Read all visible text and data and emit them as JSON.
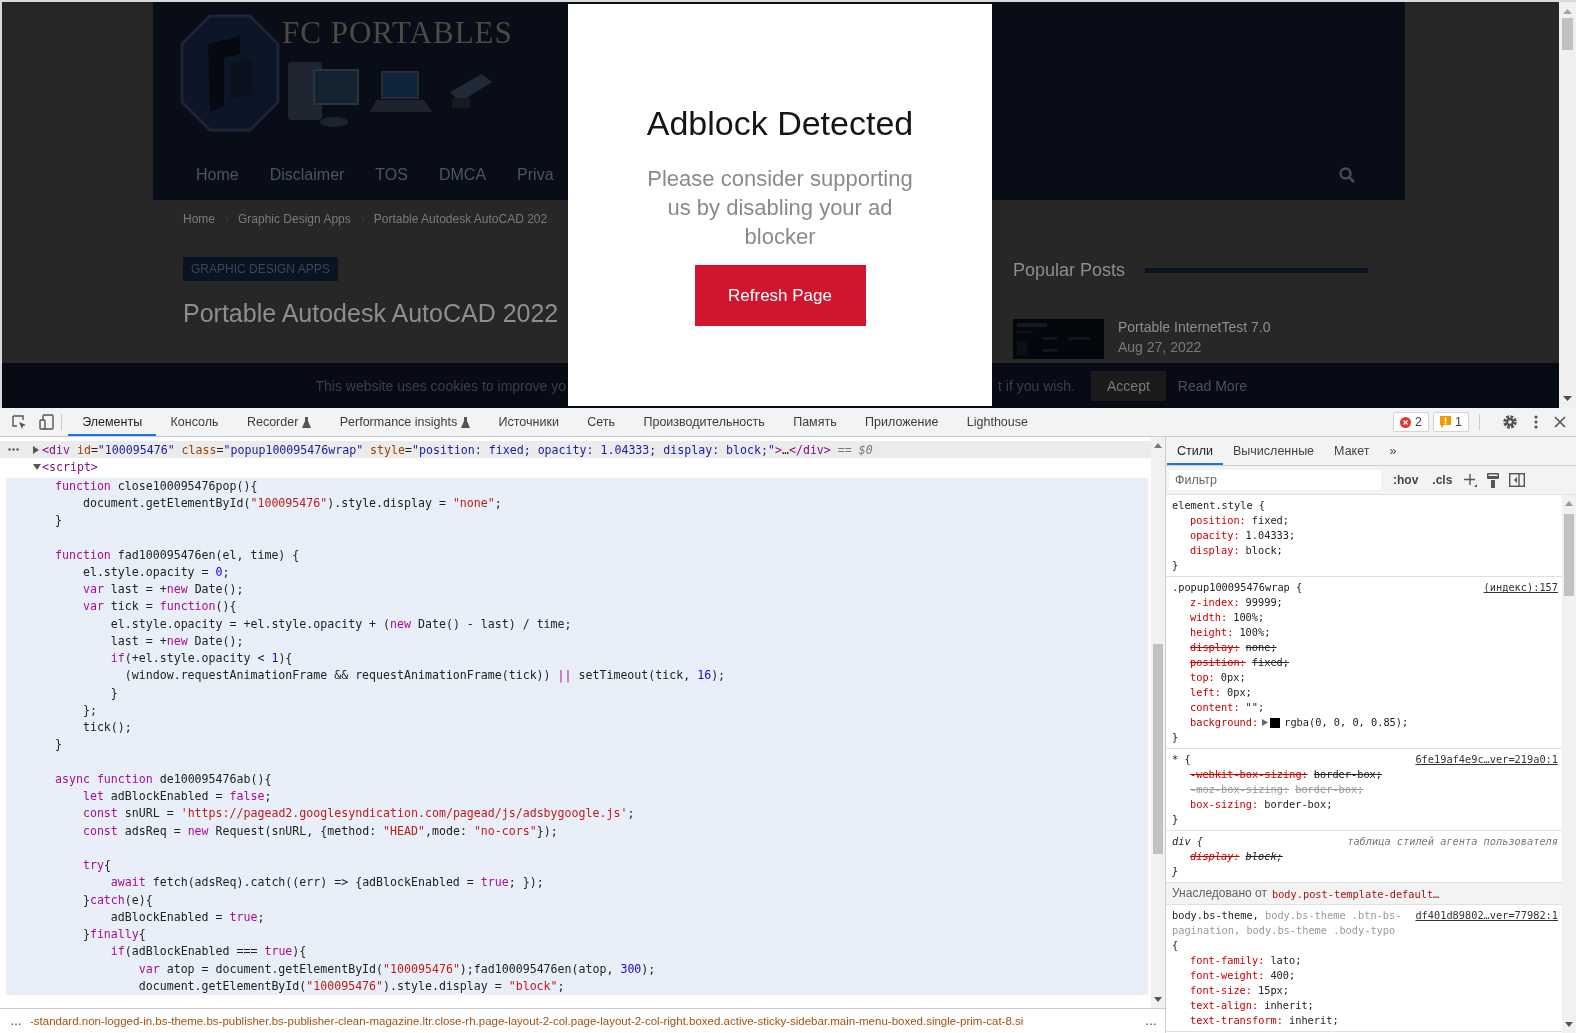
{
  "page": {
    "logo_text": "FC PORTABLES",
    "nav": [
      "Home",
      "Disclaimer",
      "TOS",
      "DMCA",
      "Priva"
    ],
    "breadcrumb": [
      "Home",
      "Graphic Design Apps",
      "Portable Autodesk AutoCAD 202"
    ],
    "category": "GRAPHIC DESIGN APPS",
    "title": "Portable Autodesk AutoCAD 2022",
    "sidebar": {
      "heading": "Popular Posts",
      "posts": [
        {
          "title": "Portable InternetTest 7.0",
          "date": "Aug 27, 2022"
        }
      ]
    },
    "cookie_bar": {
      "text_start": "This website uses cookies to improve yo",
      "text_end": "t if you wish.",
      "accept": "Accept",
      "read_more": "Read More"
    }
  },
  "modal": {
    "title": "Adblock Detected",
    "message": "Please consider supporting us by disabling your ad blocker",
    "button": "Refresh Page"
  },
  "devtools": {
    "tabs": [
      {
        "label": "Элементы",
        "selected": true,
        "experimental": false
      },
      {
        "label": "Консоль",
        "selected": false,
        "experimental": false
      },
      {
        "label": "Recorder",
        "selected": false,
        "experimental": true
      },
      {
        "label": "Performance insights",
        "selected": false,
        "experimental": true
      },
      {
        "label": "Источники",
        "selected": false,
        "experimental": false
      },
      {
        "label": "Сеть",
        "selected": false,
        "experimental": false
      },
      {
        "label": "Производительность",
        "selected": false,
        "experimental": false
      },
      {
        "label": "Память",
        "selected": false,
        "experimental": false
      },
      {
        "label": "Приложение",
        "selected": false,
        "experimental": false
      },
      {
        "label": "Lighthouse",
        "selected": false,
        "experimental": false
      }
    ],
    "errors": "2",
    "warnings": "1",
    "dom": {
      "selected_line": [
        {
          "kind": "tag",
          "text": "<div"
        },
        {
          "kind": "attribute",
          "text": " id"
        },
        "=",
        {
          "kind": "attribute-value",
          "text": "\"100095476\""
        },
        {
          "kind": "attribute",
          "text": " class"
        },
        "=",
        {
          "kind": "attribute-value",
          "text": "\"popup100095476wrap\""
        },
        {
          "kind": "attribute",
          "text": " style"
        },
        "=",
        {
          "kind": "attribute-value",
          "text": "\"position: fixed; opacity: 1.04333; display: block;\""
        },
        {
          "kind": "tag",
          "text": ">"
        },
        "…",
        {
          "kind": "tag",
          "text": "</div>"
        },
        {
          "kind": "dimmed",
          "text": " == $0"
        }
      ],
      "script_line": [
        {
          "kind": "tag",
          "text": "<script>"
        }
      ],
      "code_blocks": [
        [
          [
            {
              "kind": "keyword",
              "text": "function"
            },
            " close100095476pop(){"
          ],
          [
            "    document.getElementById(",
            {
              "kind": "string",
              "text": "\"100095476\""
            },
            ").style.display = ",
            {
              "kind": "string",
              "text": "\"none\""
            },
            ";"
          ],
          [
            "}"
          ]
        ],
        [
          [
            {
              "kind": "keyword",
              "text": "function"
            },
            " fad100095476en(el, time) {"
          ],
          [
            "    el.style.opacity = ",
            {
              "kind": "number",
              "text": "0"
            },
            ";"
          ],
          [
            {
              "kind": "keyword",
              "text": "    var"
            },
            " last = +",
            {
              "kind": "keyword",
              "text": "new"
            },
            " Date();"
          ],
          [
            {
              "kind": "keyword",
              "text": "    var"
            },
            " tick = ",
            {
              "kind": "keyword",
              "text": "function"
            },
            "(){"
          ],
          [
            "        el.style.opacity = +el.style.opacity + (",
            {
              "kind": "keyword",
              "text": "new"
            },
            " Date() - last) / time;"
          ],
          [
            "        last = +",
            {
              "kind": "keyword",
              "text": "new"
            },
            " Date();"
          ],
          [
            {
              "kind": "keyword",
              "text": "        if"
            },
            "(+el.style.opacity < ",
            {
              "kind": "number",
              "text": "1"
            },
            "){"
          ],
          [
            "          (window.requestAnimationFrame && requestAnimationFrame(tick)) ",
            {
              "kind": "keyword",
              "text": "||"
            },
            " setTimeout(tick, ",
            {
              "kind": "number",
              "text": "16"
            },
            ");"
          ],
          [
            "        }"
          ],
          [
            "    };"
          ],
          [
            "    tick();"
          ],
          [
            "}"
          ]
        ],
        [
          [
            {
              "kind": "keyword",
              "text": "async function"
            },
            " de100095476ab(){"
          ],
          [
            {
              "kind": "keyword",
              "text": "    let"
            },
            " adBlockEnabled = ",
            {
              "kind": "keyword",
              "text": "false"
            },
            ";"
          ],
          [
            {
              "kind": "keyword",
              "text": "    const"
            },
            " snURL = ",
            {
              "kind": "string",
              "text": "'https://pagead2.googlesyndication.com/pagead/js/adsbygoogle.js'"
            },
            ";"
          ],
          [
            {
              "kind": "keyword",
              "text": "    const"
            },
            " adsReq = ",
            {
              "kind": "keyword",
              "text": "new"
            },
            " Request(snURL, {method: ",
            {
              "kind": "string",
              "text": "\"HEAD\""
            },
            ",mode: ",
            {
              "kind": "string",
              "text": "\"no-cors\""
            },
            "});"
          ]
        ],
        [
          [
            {
              "kind": "keyword",
              "text": "    try"
            },
            "{"
          ],
          [
            {
              "kind": "keyword",
              "text": "        await"
            },
            " fetch(adsReq).catch((err) => {adBlockEnabled = ",
            {
              "kind": "keyword",
              "text": "true"
            },
            "; });"
          ],
          [
            "    }",
            {
              "kind": "keyword",
              "text": "catch"
            },
            "(e){"
          ],
          [
            "        adBlockEnabled = ",
            {
              "kind": "keyword",
              "text": "true"
            },
            ";"
          ],
          [
            "    }",
            {
              "kind": "keyword",
              "text": "finally"
            },
            "{"
          ],
          [
            {
              "kind": "keyword",
              "text": "        if"
            },
            "(adBlockEnabled === ",
            {
              "kind": "keyword",
              "text": "true"
            },
            "){"
          ],
          [
            {
              "kind": "keyword",
              "text": "            var"
            },
            " atop = document.getElementById(",
            {
              "kind": "string",
              "text": "\"100095476\""
            },
            ");fad100095476en(atop, ",
            {
              "kind": "number",
              "text": "300"
            },
            ");"
          ],
          [
            "            document.getElementById(",
            {
              "kind": "string",
              "text": "\"100095476\""
            },
            ").style.display = ",
            {
              "kind": "string",
              "text": "\"block\""
            },
            ";"
          ]
        ]
      ]
    },
    "status_bar": {
      "overflow_left": "…",
      "breadcrumb": "-standard.non-logged-in.bs-theme.bs-publisher.bs-publisher-clean-magazine.ltr.close-rh.page-layout-2-col.page-layout-2-col-right.boxed.active-sticky-sidebar.main-menu-boxed.single-prim-cat-8.si",
      "overflow_right": "…"
    },
    "styles": {
      "tabs": [
        {
          "label": "Стили",
          "selected": true
        },
        {
          "label": "Вычисленные",
          "selected": false
        },
        {
          "label": "Макет",
          "selected": false
        }
      ],
      "more_tabs": "»",
      "filter_placeholder": "Фильтр",
      "hov": ":hov",
      "cls": ".cls",
      "rules": [
        {
          "kind": "inline",
          "selector": [
            {
              "text": "element.style {",
              "matched": true
            }
          ],
          "declarations": [
            {
              "name": "position:",
              "value": "fixed;",
              "overridden": false,
              "invalid": false
            },
            {
              "name": "opacity:",
              "value": "1.04333;",
              "overridden": false,
              "invalid": false
            },
            {
              "name": "display:",
              "value": "block;",
              "overridden": false,
              "invalid": false
            }
          ],
          "closing": "}"
        },
        {
          "kind": "author",
          "selector": [
            {
              "text": ".popup100095476wrap {",
              "matched": true
            }
          ],
          "source": "(индекс):157",
          "declarations": [
            {
              "name": "z-index:",
              "value": "99999;",
              "overridden": false,
              "invalid": false
            },
            {
              "name": "width:",
              "value": "100%;",
              "overridden": false,
              "invalid": false
            },
            {
              "name": "height:",
              "value": "100%;",
              "overridden": false,
              "invalid": false
            },
            {
              "name": "display:",
              "value": "none;",
              "overridden": true,
              "invalid": false
            },
            {
              "name": "position:",
              "value": "fixed;",
              "overridden": true,
              "invalid": false
            },
            {
              "name": "top:",
              "value": "0px;",
              "overridden": false,
              "invalid": false
            },
            {
              "name": "left:",
              "value": "0px;",
              "overridden": false,
              "invalid": false
            },
            {
              "name": "content:",
              "value": "\"\";",
              "overridden": false,
              "invalid": false
            },
            {
              "name": "background:",
              "value": "rgba(0, 0, 0, 0.85);",
              "overridden": false,
              "invalid": false,
              "color": "#000000"
            }
          ],
          "closing": "}"
        },
        {
          "kind": "author",
          "selector": [
            {
              "text": "* {",
              "matched": true
            }
          ],
          "source": "6fe19af4e9c…ver=219a0:1",
          "declarations": [
            {
              "name": "-webkit-box-sizing:",
              "value": "border-box;",
              "overridden": true,
              "invalid": false
            },
            {
              "name": "-moz-box-sizing:",
              "value": "border-box;",
              "overridden": true,
              "invalid": true
            },
            {
              "name": "box-sizing:",
              "value": "border-box;",
              "overridden": false,
              "invalid": false
            }
          ],
          "closing": "}"
        },
        {
          "kind": "user-agent",
          "selector": [
            {
              "text": "div {",
              "matched": true
            }
          ],
          "source": "таблица стилей агента пользователя",
          "declarations": [
            {
              "name": "display:",
              "value": "block;",
              "overridden": true,
              "invalid": false
            }
          ],
          "closing": "}"
        }
      ],
      "inherited": {
        "label": "Унаследовано от",
        "selector": "body.post-template-default…",
        "rules": [
          {
            "kind": "author",
            "selector": [
              {
                "text": "body.bs-theme,",
                "matched": true
              },
              {
                "text": " body.bs-theme .btn-bs-pagination, body.bs-theme .body-typo",
                "matched": false
              },
              {
                "text": " {",
                "matched": true
              }
            ],
            "source": "df401d89802…ver=77982:1",
            "declarations": [
              {
                "name": "font-family:",
                "value": "lato;",
                "overridden": false,
                "invalid": false
              },
              {
                "name": "font-weight:",
                "value": "400;",
                "overridden": false,
                "invalid": false
              },
              {
                "name": "font-size:",
                "value": "15px;",
                "overridden": false,
                "invalid": false
              },
              {
                "name": "text-align:",
                "value": "inherit;",
                "overridden": false,
                "invalid": false
              },
              {
                "name": "text-transform:",
                "value": "inherit;",
                "overridden": false,
                "invalid": false
              }
            ]
          }
        ]
      }
    }
  }
}
